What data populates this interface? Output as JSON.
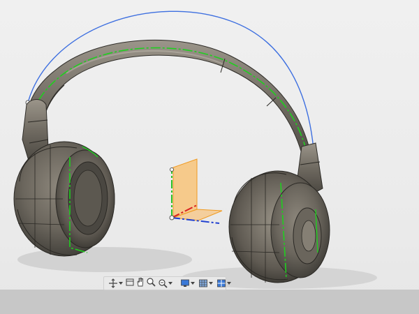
{
  "scene": {
    "object": "headphones",
    "colors": {
      "background": "#ececec",
      "body": "#6f6a60",
      "edge_green": "#1fcf1f",
      "curve_blue": "#3d6fe0",
      "sketch_plane": "#ffae3d",
      "axis_x": "#d92020",
      "axis_y": "#2ac42a",
      "axis_z": "#2040d0"
    }
  },
  "navigation_bar": {
    "items": [
      {
        "name": "orbit-button",
        "icon": "orbit-icon",
        "has_dropdown": true
      },
      {
        "name": "look-at-button",
        "icon": "look-at-icon",
        "has_dropdown": false
      },
      {
        "name": "pan-button",
        "icon": "hand-icon",
        "has_dropdown": false
      },
      {
        "name": "zoom-button",
        "icon": "zoom-icon",
        "has_dropdown": false
      },
      {
        "name": "zoom-window-button",
        "icon": "zoom-window-icon",
        "has_dropdown": true
      },
      {
        "name": "display-settings-button",
        "icon": "monitor-icon",
        "has_dropdown": true
      },
      {
        "name": "grid-settings-button",
        "icon": "grid-icon",
        "has_dropdown": true
      },
      {
        "name": "viewports-button",
        "icon": "viewports-icon",
        "has_dropdown": true
      }
    ]
  }
}
